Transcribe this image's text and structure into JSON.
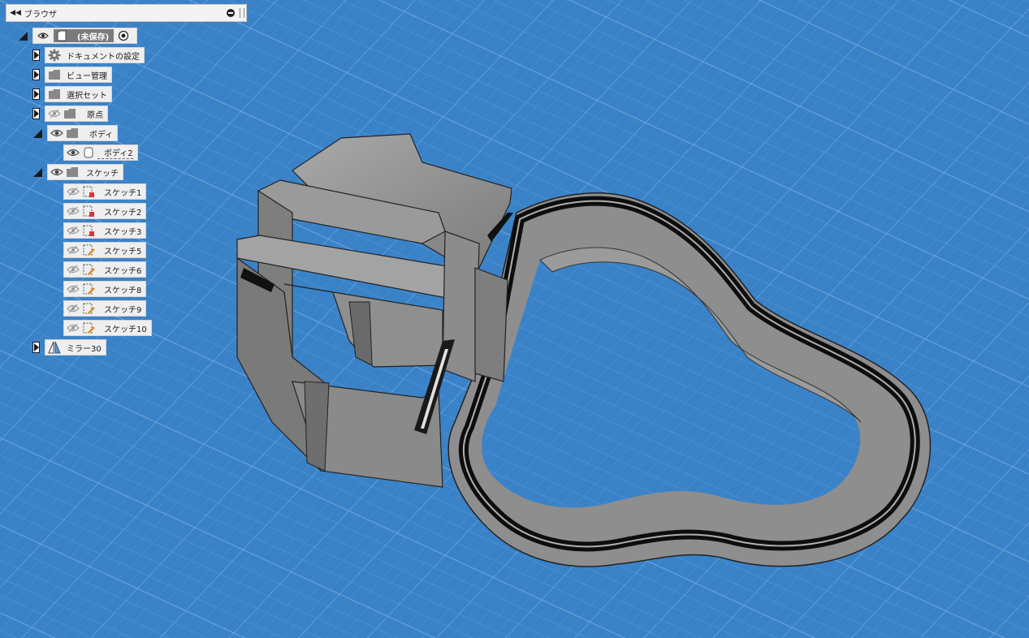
{
  "browser": {
    "title": "ブラウザ",
    "root": {
      "label": "(未保存)"
    },
    "items": [
      {
        "label": "ドキュメントの設定",
        "icon": "gear-icon"
      },
      {
        "label": "ビュー管理",
        "icon": "folder-icon"
      },
      {
        "label": "選択セット",
        "icon": "folder-icon"
      },
      {
        "label": "原点",
        "icon": "folder-icon"
      },
      {
        "label": "ボディ",
        "icon": "folder-icon"
      },
      {
        "label": "ボディ2",
        "icon": "body-icon"
      },
      {
        "label": "スケッチ",
        "icon": "folder-icon"
      },
      {
        "label": "スケッチ1",
        "icon": "sketch-locked-icon"
      },
      {
        "label": "スケッチ2",
        "icon": "sketch-locked-icon"
      },
      {
        "label": "スケッチ3",
        "icon": "sketch-locked-icon"
      },
      {
        "label": "スケッチ5",
        "icon": "sketch-pencil-icon"
      },
      {
        "label": "スケッチ6",
        "icon": "sketch-pencil-icon"
      },
      {
        "label": "スケッチ8",
        "icon": "sketch-pencil-icon"
      },
      {
        "label": "スケッチ9",
        "icon": "sketch-pencil-icon"
      },
      {
        "label": "スケッチ10",
        "icon": "sketch-pencil-icon"
      },
      {
        "label": "ミラー30",
        "icon": "mirror-icon"
      }
    ]
  },
  "colors": {
    "canvas_background": "#3a82c8",
    "grid_line": "#6aa3d8",
    "model_gray": "#8a8a8a"
  }
}
